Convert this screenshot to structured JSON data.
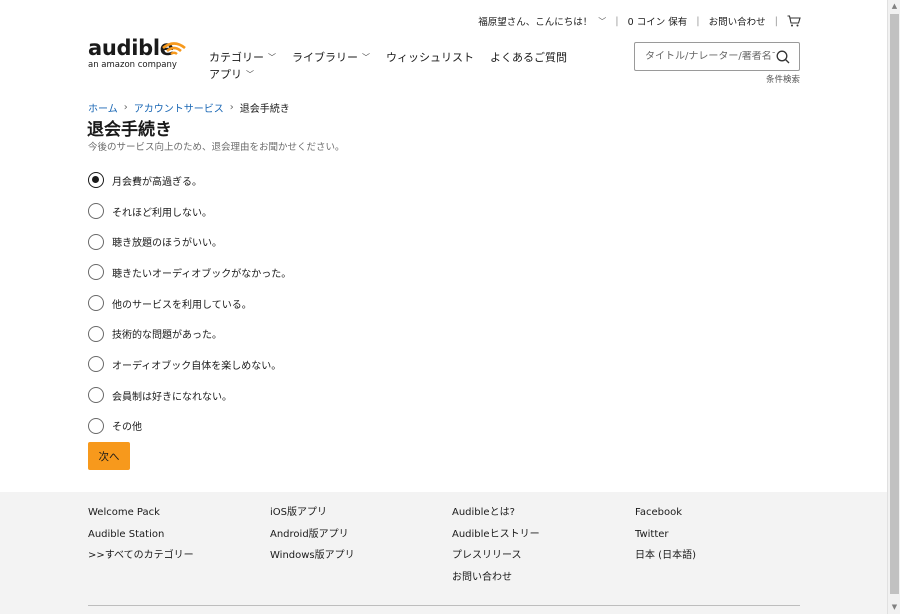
{
  "utility": {
    "greeting": "福原望さん、こんにちは！",
    "coins": "0 コイン 保有",
    "contact": "お問い合わせ"
  },
  "logo": {
    "word": "audible",
    "sub": "an amazon company"
  },
  "nav": {
    "items": [
      {
        "label": "カテゴリー"
      },
      {
        "label": "ライブラリー"
      },
      {
        "label": "ウィッシュリスト"
      },
      {
        "label": "よくあるご質問"
      },
      {
        "label": "アプリ"
      }
    ]
  },
  "search": {
    "placeholder": "タイトル/ナレーター/著者名で",
    "advanced": "条件検索"
  },
  "breadcrumb": {
    "home": "ホーム",
    "account": "アカウントサービス",
    "current": "退会手続き"
  },
  "page": {
    "title": "退会手続き",
    "lead": "今後のサービス向上のため、退会理由をお聞かせください。"
  },
  "reasons": {
    "selected_index": 0,
    "options": [
      "月会費が高過ぎる。",
      "それほど利用しない。",
      "聴き放題のほうがいい。",
      "聴きたいオーディオブックがなかった。",
      "他のサービスを利用している。",
      "技術的な問題があった。",
      "オーディオブック自体を楽しめない。",
      "会員制は好きになれない。",
      "その他"
    ]
  },
  "next_button": "次へ",
  "footer": {
    "col1": [
      "Welcome Pack",
      "Audible Station",
      ">>すべてのカテゴリー"
    ],
    "col2": [
      "iOS版アプリ",
      "Android版アプリ",
      "Windows版アプリ"
    ],
    "col3": [
      "Audibleとは?",
      "Audibleヒストリー",
      "プレスリリース",
      "お問い合わせ"
    ],
    "col4": [
      "Facebook",
      "Twitter",
      "日本 (日本語)"
    ]
  },
  "colors": {
    "accent": "#f7991c",
    "link": "#1866b4",
    "footer_bg": "#f3f3f3"
  }
}
